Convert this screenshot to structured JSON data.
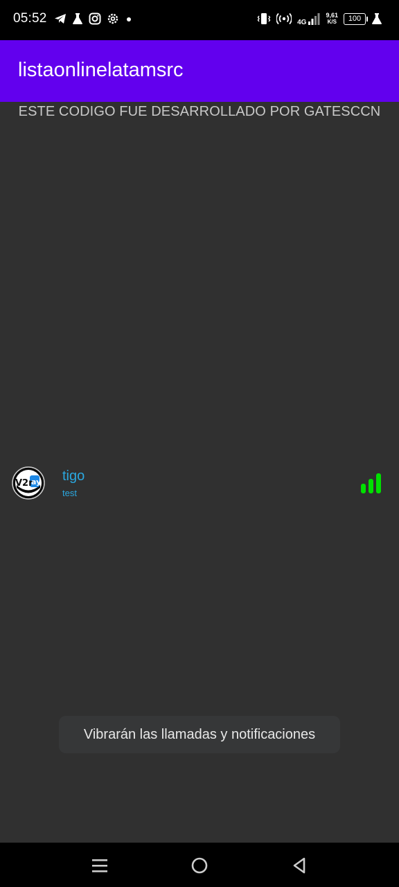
{
  "status_bar": {
    "time": "05:52",
    "left_icons": [
      "telegram-icon",
      "flask-icon",
      "instagram-icon",
      "settings-icon",
      "dot-icon"
    ],
    "network_type": "4G",
    "net_speed_value": "9,61",
    "net_speed_unit": "K/S",
    "battery_level": "100"
  },
  "app_bar": {
    "title": "listaonlinelatamsrc",
    "color": "#6200ee"
  },
  "developer_note": "ESTE CODIGO FUE DESARROLLADO POR GATESCCN",
  "servers": [
    {
      "name": "tigo",
      "description": "test",
      "logo_text": "V2ray",
      "signal_icon": "signal-bars-icon",
      "signal_color": "#00e000"
    }
  ],
  "toast": {
    "message": "Vibrarán las llamadas y notificaciones"
  },
  "nav_bar": {
    "buttons": [
      "menu-icon",
      "home-icon",
      "back-icon"
    ]
  }
}
